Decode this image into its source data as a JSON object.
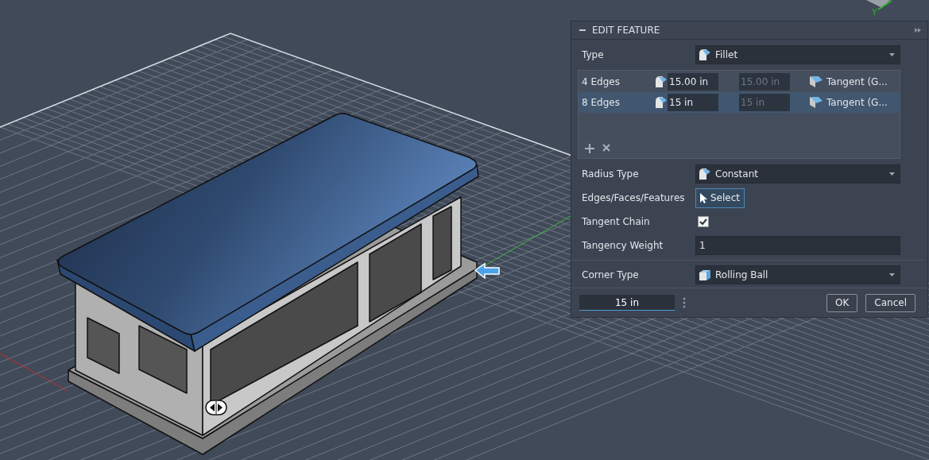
{
  "viewport": {
    "axis_label": "Y"
  },
  "panel": {
    "title": "EDIT FEATURE",
    "type": {
      "label": "Type",
      "value": "Fillet"
    },
    "edge_sets": [
      {
        "label": "4 Edges",
        "radius": "15.00 in",
        "radius_end": "15.00 in",
        "continuity": "Tangent (G...",
        "selected": false
      },
      {
        "label": "8 Edges",
        "radius": "15 in",
        "radius_end": "15 in",
        "continuity": "Tangent (G...",
        "selected": true
      }
    ],
    "fields": [
      {
        "kind": "dropdown",
        "label": "Radius Type",
        "value": "Constant"
      },
      {
        "kind": "select",
        "label": "Edges/Faces/Features",
        "value": "Select"
      },
      {
        "kind": "checkbox",
        "label": "Tangent Chain",
        "checked": true
      },
      {
        "kind": "input",
        "label": "Tangency Weight",
        "value": "1"
      }
    ],
    "corner_type": {
      "label": "Corner Type",
      "value": "Rolling Ball"
    },
    "footer": {
      "value": "15 in",
      "ok": "OK",
      "cancel": "Cancel"
    }
  }
}
